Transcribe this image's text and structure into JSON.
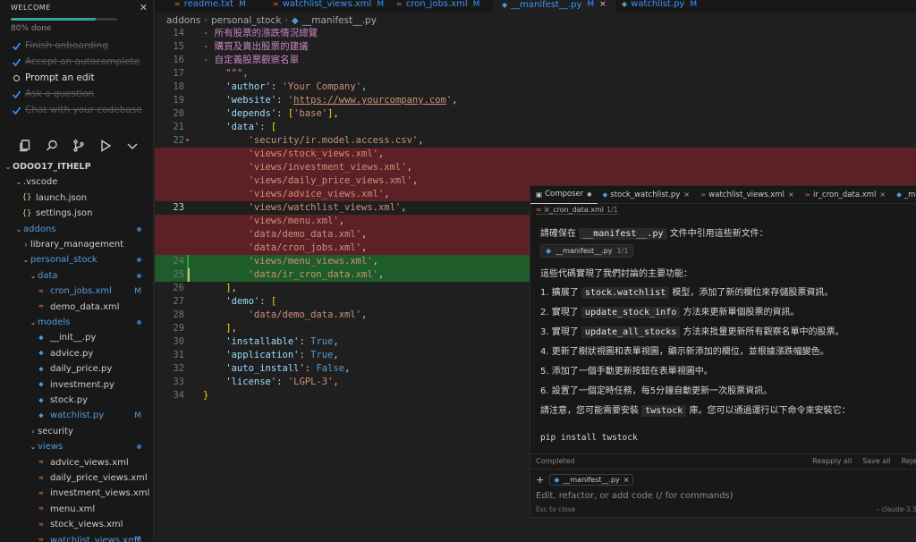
{
  "welcome": {
    "title": "WELCOME",
    "progress_text": "80% done",
    "progress_fraction": 0.8,
    "steps": [
      {
        "label": "Finish onboarding",
        "done": true
      },
      {
        "label": "Accept an autocomplete",
        "done": true
      },
      {
        "label": "Prompt an edit",
        "done": false
      },
      {
        "label": "Ask a question",
        "done": true
      },
      {
        "label": "Chat with your codebase",
        "done": true
      }
    ]
  },
  "activity_bar": [
    "files-icon",
    "search-icon",
    "source-control-icon",
    "run-debug-icon",
    "chevron-down-icon"
  ],
  "explorer": {
    "root": "ODOO17_ITHELP",
    "rows": [
      {
        "label": "ODOO17_ITHELP",
        "type": "root"
      },
      {
        "label": ".vscode",
        "type": "folder",
        "open": true
      },
      {
        "label": "launch.json",
        "type": "json"
      },
      {
        "label": "settings.json",
        "type": "json"
      },
      {
        "label": "addons",
        "type": "folder",
        "open": true,
        "modified": true
      },
      {
        "label": "library_management",
        "type": "folder",
        "open": false
      },
      {
        "label": "personal_stock",
        "type": "folder",
        "open": true,
        "modified": true
      },
      {
        "label": "data",
        "type": "folder",
        "open": true,
        "modified": true
      },
      {
        "label": "cron_jobs.xml",
        "type": "xml",
        "modified": true,
        "badge": "M"
      },
      {
        "label": "demo_data.xml",
        "type": "xml"
      },
      {
        "label": "models",
        "type": "folder",
        "open": true,
        "modified": true
      },
      {
        "label": "__init__.py",
        "type": "py"
      },
      {
        "label": "advice.py",
        "type": "py"
      },
      {
        "label": "daily_price.py",
        "type": "py"
      },
      {
        "label": "investment.py",
        "type": "py"
      },
      {
        "label": "stock.py",
        "type": "py"
      },
      {
        "label": "watchlist.py",
        "type": "py",
        "modified": true,
        "badge": "M"
      },
      {
        "label": "security",
        "type": "folder",
        "open": false
      },
      {
        "label": "views",
        "type": "folder",
        "open": true,
        "modified": true
      },
      {
        "label": "advice_views.xml",
        "type": "xml"
      },
      {
        "label": "daily_price_views.xml",
        "type": "xml"
      },
      {
        "label": "investment_views.xml",
        "type": "xml"
      },
      {
        "label": "menu.xml",
        "type": "xml"
      },
      {
        "label": "stock_views.xml",
        "type": "xml"
      },
      {
        "label": "watchlist_views.xml",
        "type": "xml",
        "modified": true,
        "badge": "M"
      }
    ]
  },
  "tabs": [
    {
      "label": "readme.txt",
      "badge": "M",
      "icon": "txt-icon"
    },
    {
      "label": "watchlist_views.xml",
      "badge": "M",
      "icon": "xml-icon"
    },
    {
      "label": "cron_jobs.xml",
      "badge": "M",
      "icon": "xml-icon"
    },
    {
      "label": "__manifest__.py",
      "badge": "M",
      "icon": "python-icon",
      "active": true
    },
    {
      "label": "watchlist.py",
      "badge": "M",
      "icon": "python-icon"
    }
  ],
  "breadcrumb": [
    "addons",
    "personal_stock",
    "__manifest__.py"
  ],
  "code": [
    {
      "n": "14",
      "tokens": [
        [
          "c-cm",
          "- 所有股票的漲跌情況總覽"
        ]
      ]
    },
    {
      "n": "15",
      "tokens": [
        [
          "c-cm",
          "- 購買及賣出股票的建議"
        ]
      ]
    },
    {
      "n": "16",
      "tokens": [
        [
          "c-cm",
          "- 自定義股票觀察名單"
        ]
      ]
    },
    {
      "n": "17",
      "tokens": [
        [
          "c-str",
          "    \"\"\","
        ]
      ]
    },
    {
      "n": "18",
      "tokens": [
        [
          "c-key",
          "    'author'"
        ],
        [
          "",
          ": "
        ],
        [
          "c-str",
          "'Your Company'"
        ],
        [
          "",
          ","
        ]
      ]
    },
    {
      "n": "19",
      "tokens": [
        [
          "c-key",
          "    'website'"
        ],
        [
          "",
          ": "
        ],
        [
          "c-str",
          "'"
        ],
        [
          "c-url",
          "https://www.yourcompany.com"
        ],
        [
          "c-str",
          "'"
        ],
        [
          "",
          ","
        ]
      ]
    },
    {
      "n": "20",
      "tokens": [
        [
          "c-key",
          "    'depends'"
        ],
        [
          "",
          ": "
        ],
        [
          "c-br",
          "["
        ],
        [
          "c-str",
          "'base'"
        ],
        [
          "c-br",
          "]"
        ],
        [
          "",
          ","
        ]
      ]
    },
    {
      "n": "21",
      "tokens": [
        [
          "c-key",
          "    'data'"
        ],
        [
          "",
          ": "
        ],
        [
          "c-br",
          "["
        ]
      ]
    },
    {
      "n": "22",
      "tokens": [
        [
          "c-str",
          "        'security/ir.model.access.csv'"
        ],
        [
          "",
          ","
        ]
      ]
    },
    {
      "n": "",
      "tokens": [
        [
          "c-str",
          "        'views/stock_views.xml'"
        ],
        [
          "",
          ","
        ]
      ],
      "diff": "del"
    },
    {
      "n": "",
      "tokens": [
        [
          "c-str",
          "        'views/investment_views.xml'"
        ],
        [
          "",
          ","
        ]
      ],
      "diff": "del"
    },
    {
      "n": "",
      "tokens": [
        [
          "c-str",
          "        'views/daily_price_views.xml'"
        ],
        [
          "",
          ","
        ]
      ],
      "diff": "del"
    },
    {
      "n": "",
      "tokens": [
        [
          "c-str",
          "        'views/advice_views.xml'"
        ],
        [
          "",
          ","
        ]
      ],
      "diff": "del"
    },
    {
      "n": "23",
      "tokens": [
        [
          "c-str",
          "        'views/watchlist_views.xml'"
        ],
        [
          "",
          ","
        ]
      ],
      "current": true
    },
    {
      "n": "",
      "tokens": [
        [
          "c-str",
          "        'views/menu.xml'"
        ],
        [
          "",
          ","
        ]
      ],
      "diff": "del"
    },
    {
      "n": "",
      "tokens": [
        [
          "c-str",
          "        'data/demo_data.xml'"
        ],
        [
          "",
          ","
        ]
      ],
      "diff": "del"
    },
    {
      "n": "",
      "tokens": [
        [
          "c-str",
          "        'data/cron_jobs.xml'"
        ],
        [
          "",
          ","
        ]
      ],
      "diff": "del"
    },
    {
      "n": "24",
      "tokens": [
        [
          "c-str",
          "        'views/menu_views.xml'"
        ],
        [
          "",
          ","
        ]
      ],
      "diff": "add"
    },
    {
      "n": "25",
      "tokens": [
        [
          "c-str",
          "        'data/ir_cron_data.xml'"
        ],
        [
          "",
          ","
        ]
      ],
      "diff": "add"
    },
    {
      "n": "26",
      "tokens": [
        [
          "c-br",
          "    ]"
        ],
        [
          "",
          ","
        ]
      ]
    },
    {
      "n": "27",
      "tokens": [
        [
          "c-key",
          "    'demo'"
        ],
        [
          "",
          ": "
        ],
        [
          "c-br",
          "["
        ]
      ]
    },
    {
      "n": "28",
      "tokens": [
        [
          "c-str",
          "        'data/demo_data.xml'"
        ],
        [
          "",
          ","
        ]
      ]
    },
    {
      "n": "29",
      "tokens": [
        [
          "c-br",
          "    ]"
        ],
        [
          "",
          ","
        ]
      ]
    },
    {
      "n": "30",
      "tokens": [
        [
          "c-key",
          "    'installable'"
        ],
        [
          "",
          ": "
        ],
        [
          "c-kw",
          "True"
        ],
        [
          "",
          ","
        ]
      ]
    },
    {
      "n": "31",
      "tokens": [
        [
          "c-key",
          "    'application'"
        ],
        [
          "",
          ": "
        ],
        [
          "c-kw",
          "True"
        ],
        [
          "",
          ","
        ]
      ]
    },
    {
      "n": "32",
      "tokens": [
        [
          "c-key",
          "    'auto_install'"
        ],
        [
          "",
          ": "
        ],
        [
          "c-kw",
          "False"
        ],
        [
          "",
          ","
        ]
      ]
    },
    {
      "n": "33",
      "tokens": [
        [
          "c-key",
          "    'license'"
        ],
        [
          "",
          ": "
        ],
        [
          "c-str",
          "'LGPL-3'"
        ],
        [
          "",
          ","
        ]
      ]
    },
    {
      "n": "34",
      "tokens": [
        [
          "c-br",
          "}"
        ]
      ]
    }
  ],
  "composer": {
    "tabs": [
      {
        "label": "Composer",
        "icon": "composer-icon",
        "dot": true
      },
      {
        "label": "stock_watchlist.py",
        "icon": "python-icon"
      },
      {
        "label": "watchlist_views.xml",
        "icon": "xml-icon"
      },
      {
        "label": "ir_cron_data.xml",
        "icon": "xml-icon"
      },
      {
        "label": "_ma",
        "icon": "python-icon"
      }
    ],
    "sub_file": "ir_cron_data.xml",
    "sub_count": "1/1",
    "intro_prefix": "請確保在",
    "intro_code": "__manifest__.py",
    "intro_suffix": "文件中引用這些新文件：",
    "chip_file": "__manifest__.py",
    "chip_count": "1/1",
    "features_intro": "這些代碼實現了我們討論的主要功能：",
    "items": [
      {
        "prefix": "1. 擴展了",
        "code": "stock.watchlist",
        "suffix": "模型，添加了新的欄位來存儲股票資訊。"
      },
      {
        "prefix": "2. 實現了",
        "code": "update_stock_info",
        "suffix": "方法來更新單個股票的資訊。"
      },
      {
        "prefix": "3. 實現了",
        "code": "update_all_stocks",
        "suffix": "方法來批量更新所有觀察名單中的股票。"
      },
      {
        "prefix": "4. 更新了樹狀視圖和表單視圖，顯示新添加的欄位，並根據漲跌幅變色。",
        "code": "",
        "suffix": ""
      },
      {
        "prefix": "5. 添加了一個手動更新按鈕在表單視圖中。",
        "code": "",
        "suffix": ""
      },
      {
        "prefix": "6. 設置了一個定時任務，每5分鐘自動更新一次股票資訊。",
        "code": "",
        "suffix": ""
      }
    ],
    "note_prefix": "請注意，您可能需要安裝",
    "note_code": "twstock",
    "note_suffix": "庫。您可以通過運行以下命令來安裝它：",
    "pip_cmd": "pip install twstock",
    "status": "Completed",
    "reapply": "Reapply all",
    "save_all": "Save all",
    "reject": "Reje",
    "context_file": "__manifest__.py",
    "input_placeholder": "Edit, refactor, or add code (/ for commands)",
    "esc_hint": "Esc to close",
    "model_label": "claude-3.5"
  }
}
